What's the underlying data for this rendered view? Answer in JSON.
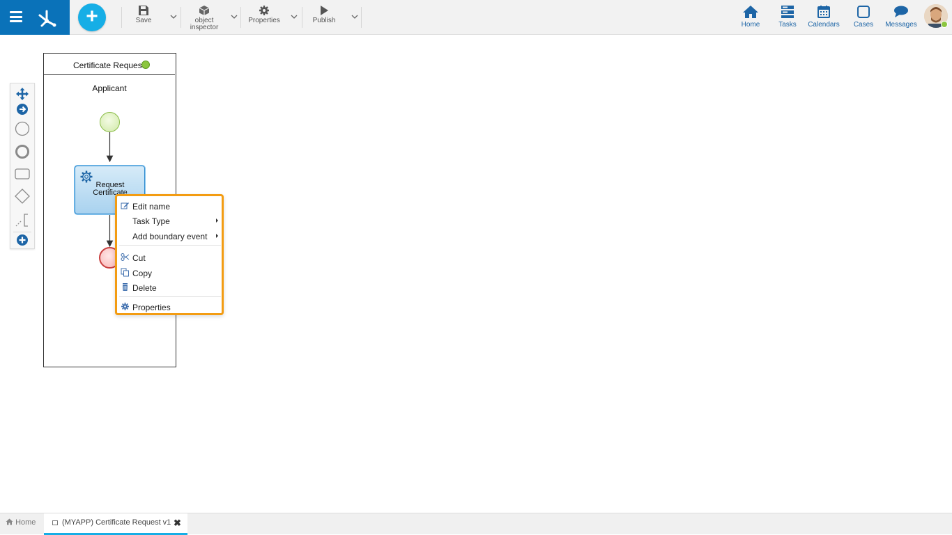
{
  "toolbar": {
    "save_label": "Save",
    "object_inspector_line1": "object",
    "object_inspector_line2": "inspector",
    "properties_label": "Properties",
    "publish_label": "Publish"
  },
  "nav": {
    "home": "Home",
    "tasks": "Tasks",
    "calendars": "Calendars",
    "cases": "Cases",
    "messages": "Messages"
  },
  "diagram": {
    "pool_title": "Certificate Request",
    "lane_title": "Applicant",
    "task_line1": "Request",
    "task_line2": "Certificate"
  },
  "context_menu": {
    "edit_name": "Edit name",
    "task_type": "Task Type",
    "add_boundary_event": "Add boundary event",
    "cut": "Cut",
    "copy": "Copy",
    "delete": "Delete",
    "properties": "Properties"
  },
  "tabs": {
    "home": "Home",
    "active": "(MYAPP) Certificate Request v1",
    "close_glyph": "✖"
  },
  "colors": {
    "brand": "#0a72b9",
    "accent": "#16aee6",
    "menu_highlight_border": "#f39c12",
    "status_green": "#8cc63f"
  },
  "icons": [
    "hamburger-icon",
    "app-logo",
    "plus-icon",
    "save-icon",
    "cube-icon",
    "gear-icon",
    "play-icon",
    "home-icon",
    "tasks-icon",
    "calendar-icon",
    "cases-icon",
    "messages-icon",
    "move-icon",
    "connector-icon",
    "start-event-icon",
    "end-event-icon",
    "task-shape-icon",
    "gateway-icon",
    "annotation-icon",
    "add-icon",
    "edit-icon",
    "scissors-icon",
    "copy-icon",
    "trash-icon"
  ]
}
